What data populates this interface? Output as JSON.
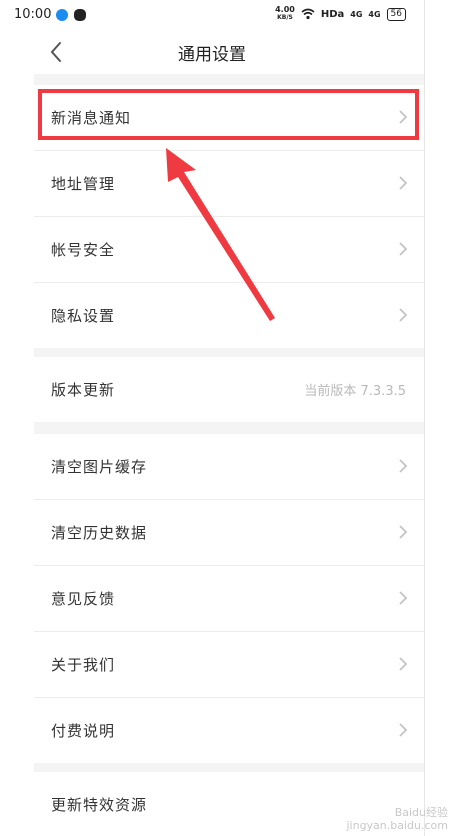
{
  "status_bar": {
    "time": "10:00",
    "net_speed": "4.00",
    "net_unit": "KB/S",
    "hd": "HDa",
    "sig1": "4G",
    "sig2": "4G",
    "battery": "56",
    "app_icon_colors": [
      "#1b8cf0",
      "#222222"
    ]
  },
  "header": {
    "title": "通用设置",
    "back_icon": "chevron-left-icon"
  },
  "groups": [
    {
      "items": [
        {
          "label": "新消息通知"
        },
        {
          "label": "地址管理"
        },
        {
          "label": "帐号安全"
        },
        {
          "label": "隐私设置"
        }
      ]
    },
    {
      "items": [
        {
          "label": "版本更新",
          "value": "当前版本 7.3.3.5"
        }
      ]
    },
    {
      "items": [
        {
          "label": "清空图片缓存"
        },
        {
          "label": "清空历史数据"
        },
        {
          "label": "意见反馈"
        },
        {
          "label": "关于我们"
        },
        {
          "label": "付费说明"
        }
      ]
    },
    {
      "items": [
        {
          "label": "更新特效资源"
        }
      ]
    }
  ],
  "annotation": {
    "color": "#ef3a41"
  },
  "watermark": {
    "line1": "Baidu经验",
    "line2": "jingyan.baidu.com"
  }
}
